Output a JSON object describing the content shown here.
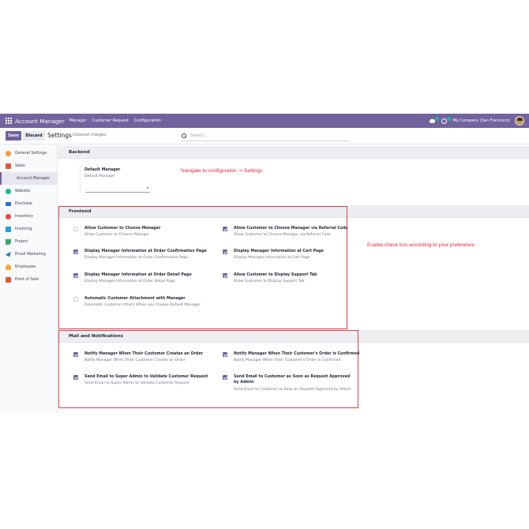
{
  "topbar": {
    "app_title": "Account Manager",
    "menu": [
      "Manager",
      "Customer Request",
      "Configuration"
    ],
    "chat_count": "8",
    "activity_count": "7",
    "company": "My Company (San Francisco)",
    "accent": "#71639e"
  },
  "control_panel": {
    "save_label": "Save",
    "discard_label": "Discard",
    "title": "Settings",
    "unsaved": "Unsaved changes",
    "search_placeholder": "Search..."
  },
  "sidebar": {
    "items": [
      {
        "label": "General Settings",
        "icon": "gear-icon",
        "color": "#f2994a"
      },
      {
        "label": "Sales",
        "icon": "chart-icon",
        "color": "#e5533d"
      },
      {
        "label": "Account Manager",
        "icon": "",
        "color": ""
      },
      {
        "label": "Website",
        "icon": "globe-icon",
        "color": "#21b799"
      },
      {
        "label": "Purchase",
        "icon": "card-icon",
        "color": "#2f6fd0"
      },
      {
        "label": "Inventory",
        "icon": "box-icon",
        "color": "#ef4444"
      },
      {
        "label": "Invoicing",
        "icon": "invoice-icon",
        "color": "#1f9fd8"
      },
      {
        "label": "Project",
        "icon": "check-icon",
        "color": "#3fa66b"
      },
      {
        "label": "Email Marketing",
        "icon": "send-icon",
        "color": "#2f6fd0"
      },
      {
        "label": "Employees",
        "icon": "people-icon",
        "color": "#f0a93b"
      },
      {
        "label": "Point of Sale",
        "icon": "store-icon",
        "color": "#e5533d"
      }
    ]
  },
  "backend": {
    "title": "Backend",
    "default_manager_label": "Default Manager",
    "default_manager_desc": "Default Manager",
    "default_manager_value": ""
  },
  "frontend": {
    "title": "Frontend",
    "settings": [
      {
        "title": "Allow Customer to Choose Manager",
        "desc": "Allow Customer to Choose Manager",
        "checked": false
      },
      {
        "title": "Allow Customer to Choose Manager via Referral Code",
        "desc": "Allow Customer to Choose Manager via Referral Code",
        "checked": true
      },
      {
        "title": "Display Manager Information at Order Confirmation Page",
        "desc": "Display Manager Information at Order Confirmation Page",
        "checked": true
      },
      {
        "title": "Display Manager Information at Cart Page",
        "desc": "Display Manager Information at Cart Page",
        "checked": true
      },
      {
        "title": "Display Manager Information at Order Detail Page",
        "desc": "Display Manager Information at Order Detail Page",
        "checked": true
      },
      {
        "title": "Allow Customer to Display Support Tab",
        "desc": "Allow Customer to Display Support Tab",
        "checked": true
      },
      {
        "title": "Automatic Customer Attachment with Manager",
        "desc": "Automatic Customer Attach When you Choose Default Manager",
        "checked": false
      }
    ]
  },
  "mail": {
    "title": "Mail and Notifications",
    "settings": [
      {
        "title": "Notify Manager When Their Customer Creates an Order",
        "desc": "Notify Manager When Their Customer Creates an Order",
        "checked": true
      },
      {
        "title": "Notify Manager When Their Customer's Order is Confirmed",
        "desc": "Notify Manager When Their Customer's Order is Confirmed",
        "checked": true
      },
      {
        "title": "Send Email to Super Admin to Validate Customer Request",
        "desc": "Send Email to Super Admin to Validate Customer Request",
        "checked": true
      },
      {
        "title": "Send Email to Customer as Soon as Request Approved by Admin",
        "desc": "Send Email to Customer as Soon as Request Approved by Admin",
        "checked": true
      }
    ]
  },
  "annotations": {
    "navigate": "Navigate to configuraton -> Settings",
    "enable": "Enable check box according to your preference.",
    "color": "#e8263b"
  }
}
